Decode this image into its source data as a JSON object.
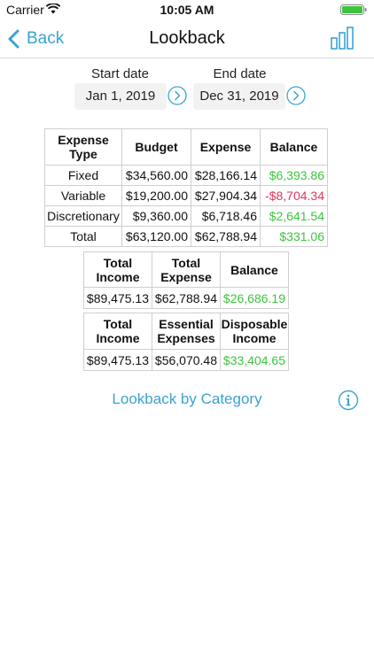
{
  "status_bar": {
    "carrier": "Carrier",
    "time": "10:05 AM"
  },
  "nav": {
    "back_label": "Back",
    "title": "Lookback",
    "chart_icon": "bar-chart-icon"
  },
  "dates": {
    "start_label": "Start date",
    "start_value": "Jan 1, 2019",
    "end_label": "End date",
    "end_value": "Dec 31, 2019"
  },
  "expense_table": {
    "headers": [
      "Expense Type",
      "Budget",
      "Expense",
      "Balance"
    ],
    "rows": [
      {
        "type": "Fixed",
        "budget": "$34,560.00",
        "expense": "$28,166.14",
        "balance": "$6,393.86",
        "balance_status": "positive"
      },
      {
        "type": "Variable",
        "budget": "$19,200.00",
        "expense": "$27,904.34",
        "balance": "-$8,704.34",
        "balance_status": "negative"
      },
      {
        "type": "Discretionary",
        "budget": "$9,360.00",
        "expense": "$6,718.46",
        "balance": "$2,641.54",
        "balance_status": "positive"
      },
      {
        "type": "Total",
        "budget": "$63,120.00",
        "expense": "$62,788.94",
        "balance": "$331.06",
        "balance_status": "positive"
      }
    ]
  },
  "balance_table": {
    "headers": [
      "Total Income",
      "Total Expense",
      "Balance"
    ],
    "values": [
      "$89,475.13",
      "$62,788.94",
      "$26,686.19"
    ]
  },
  "disposable_table": {
    "headers": [
      "Total Income",
      "Essential Expenses",
      "Disposable Income"
    ],
    "values": [
      "$89,475.13",
      "$56,070.48",
      "$33,404.65"
    ]
  },
  "lookback_category_label": "Lookback by Category",
  "colors": {
    "accent": "#3aa3d4",
    "positive": "#3dc43d",
    "negative": "#e0365b",
    "battery": "#3dc43d"
  }
}
